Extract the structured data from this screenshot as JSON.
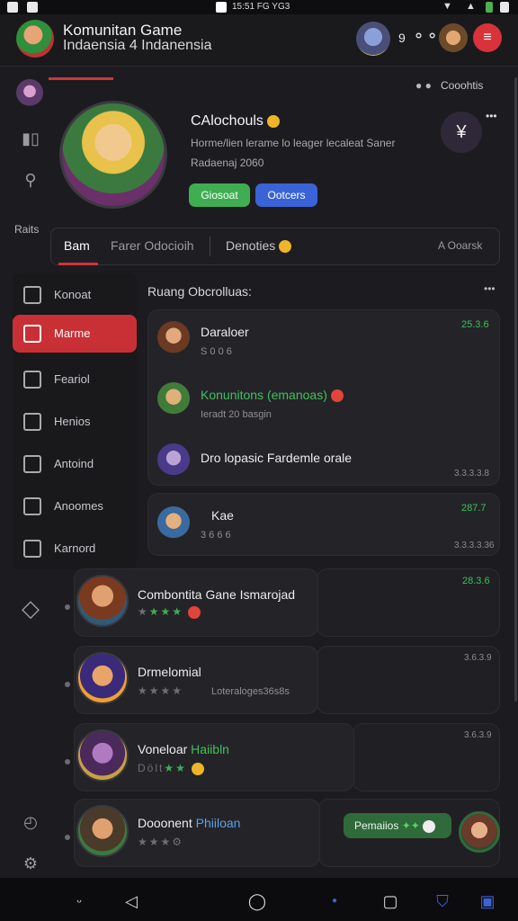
{
  "status_bar": {
    "time": "15:51 FG YG3"
  },
  "header": {
    "title": "Komunitan Game",
    "subtitle": "Indaensia 4 Indanensia",
    "badge_count": "9",
    "accent": "#d0343a"
  },
  "top_right": {
    "more_label": "Cooohtis"
  },
  "profile": {
    "name": "CAlochouls",
    "bio": "Horme/lien lerame lo leager lecaleat Saner",
    "meta": "Radaenaj 2060",
    "btn_green": "Giosoat",
    "btn_blue": "Ootcers"
  },
  "left_rail": {
    "label": "Raits"
  },
  "tabs": [
    {
      "label": "Bam"
    },
    {
      "label": "Farer Odocioih"
    },
    {
      "label": "Denoties"
    },
    {
      "label": "A Ooarsk"
    }
  ],
  "side_menu": [
    {
      "label": "Konoat",
      "icon": "home-icon"
    },
    {
      "label": "Marme",
      "icon": "image-icon"
    },
    {
      "label": "Feariol",
      "icon": "folder-icon"
    },
    {
      "label": "Henios",
      "icon": "controller-icon"
    },
    {
      "label": "Antoind",
      "icon": "device-icon"
    },
    {
      "label": "Anoomes",
      "icon": "bag-icon"
    },
    {
      "label": "Karnord",
      "icon": "alert-icon"
    }
  ],
  "section": {
    "title": "Ruang Obcrolluas:"
  },
  "card1": [
    {
      "title": "Daraloer",
      "sub": "S 0 0 6",
      "val": "25.3.6"
    },
    {
      "title": "Konunitons (emanoas)",
      "sub": "Ieradt 20 basgin"
    },
    {
      "title": "Dro lopasic Fardemle orale",
      "time": "3.3.3.3.8"
    }
  ],
  "card2": {
    "title": "Kae",
    "sub": "3 6 6 6",
    "val": "287.7",
    "time": "3.3.3.3.36"
  },
  "feed": [
    {
      "title": "Combontita Gane Ismarojad",
      "val": "28.3.6"
    },
    {
      "title": "Drmelomial",
      "sub": "Loteraloges36s8s",
      "val": "3.6.3.9"
    },
    {
      "title": "Voneloar",
      "title_tag": "Haiibln",
      "sub": "Dölt",
      "val": "3.6.3.9"
    },
    {
      "title": "Dooonent",
      "title_tag": "Phiiloan"
    }
  ],
  "fab": {
    "label": "Pemaiios"
  },
  "colors": {
    "green": "#3fae52",
    "blue": "#3b63d8",
    "red": "#c83036"
  }
}
